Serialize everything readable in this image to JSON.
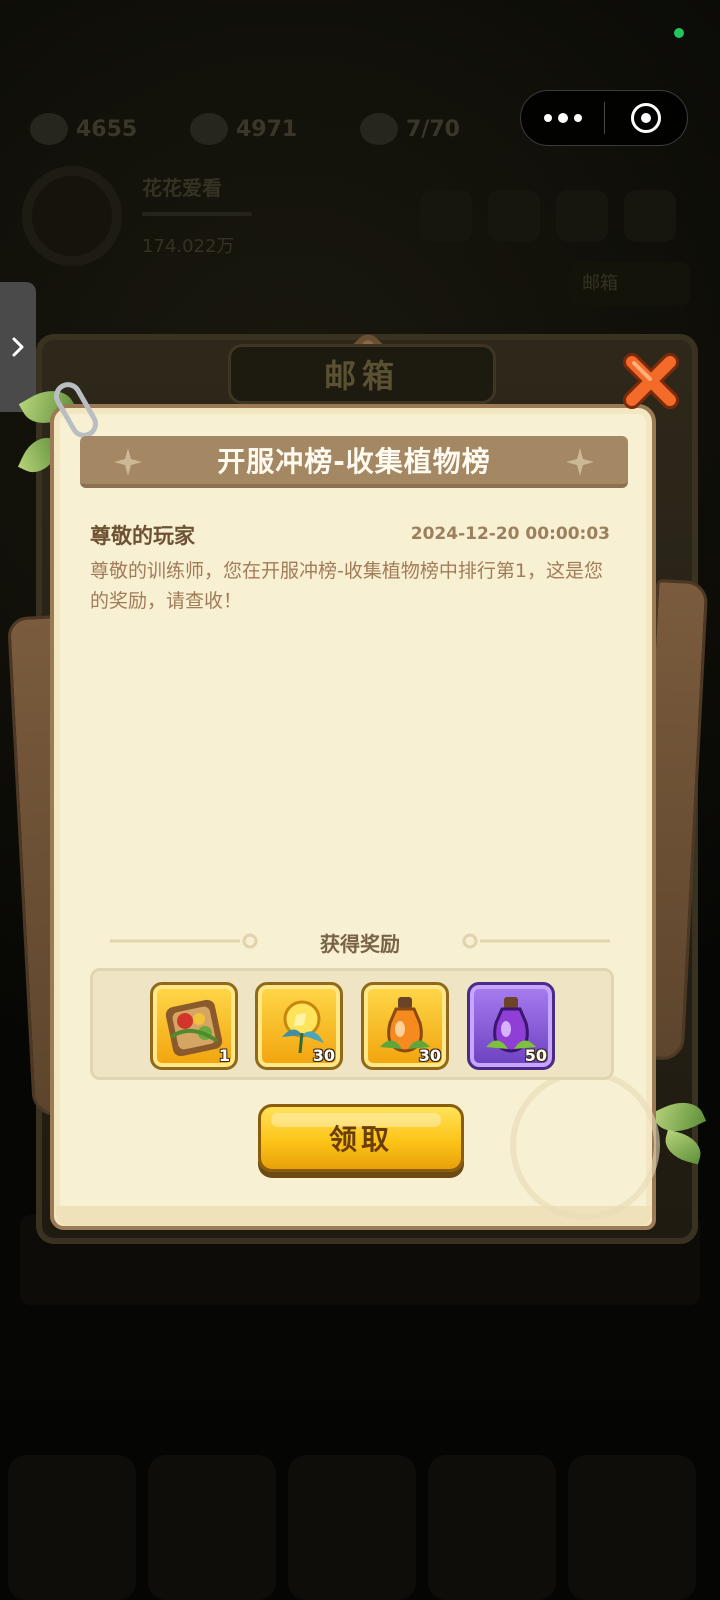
{
  "background": {
    "resources": [
      {
        "icon": "coin-icon",
        "value": "4655"
      },
      {
        "icon": "gem-icon",
        "value": "4971"
      },
      {
        "icon": "energy-icon",
        "value": "7/70"
      }
    ],
    "player_name": "花花爱看",
    "money": "174.022万",
    "right_tag": "邮箱",
    "low_text": ""
  },
  "capsule": {
    "more_icon": "more-dots-icon",
    "close_icon": "target-icon"
  },
  "side_tab": {
    "icon": "chevron-right-icon"
  },
  "window": {
    "title": "邮箱",
    "close_icon": "close-x-icon"
  },
  "mail": {
    "banner_title": "开服冲榜-收集植物榜",
    "sender": "尊敬的玩家",
    "timestamp": "2024-12-20 00:00:03",
    "body": "尊敬的训练师，您在开服冲榜-收集植物榜中排行第1，这是您的奖励，请查收！"
  },
  "rewards": {
    "title": "获得奖励",
    "items": [
      {
        "icon": "seed-basket-icon",
        "count": "1"
      },
      {
        "icon": "golden-seed-icon",
        "count": "30"
      },
      {
        "icon": "orange-potion-icon",
        "count": "30"
      },
      {
        "icon": "purple-potion-icon",
        "count": "50"
      }
    ]
  },
  "claim_button": {
    "label": "领取"
  },
  "colors": {
    "paper": "#f8f0d3",
    "banner": "#a48763",
    "claim_yellow": "#fcc417",
    "close_orange": "#f46a28"
  }
}
